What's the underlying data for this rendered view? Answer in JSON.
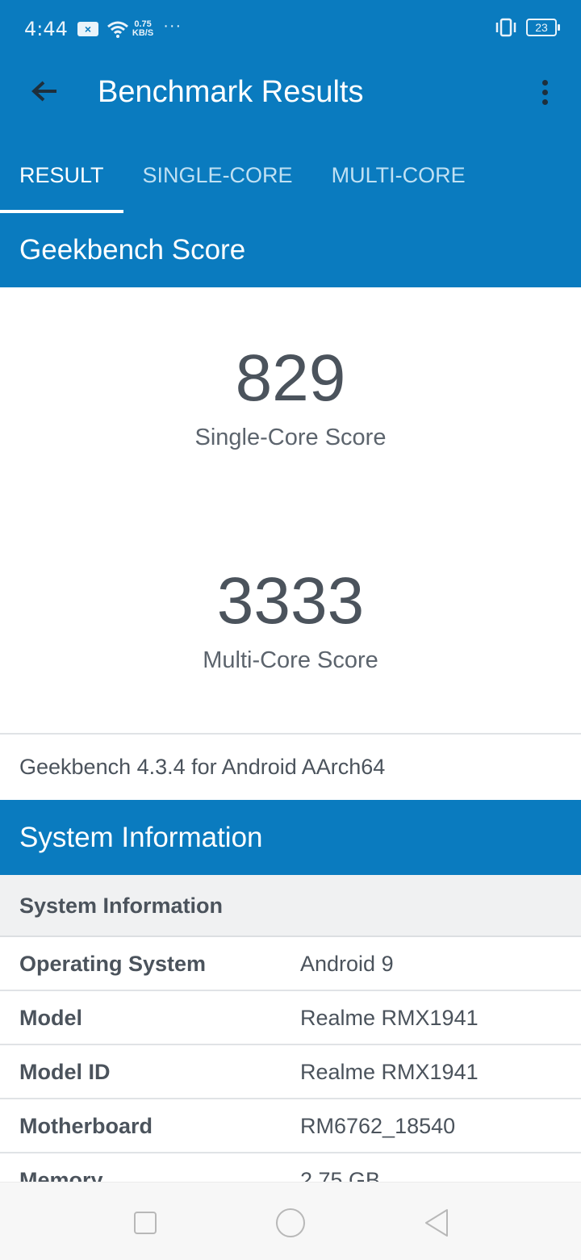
{
  "status_bar": {
    "time": "4:44",
    "net_speed_value": "0.75",
    "net_speed_unit": "KB/S",
    "overflow": "···",
    "battery": "23"
  },
  "app_bar": {
    "title": "Benchmark Results"
  },
  "tabs": [
    {
      "label": "RESULT",
      "active": true
    },
    {
      "label": "SINGLE-CORE",
      "active": false
    },
    {
      "label": "MULTI-CORE",
      "active": false
    }
  ],
  "geekbench": {
    "header": "Geekbench Score",
    "single_core_value": "829",
    "single_core_label": "Single-Core Score",
    "multi_core_value": "3333",
    "multi_core_label": "Multi-Core Score",
    "version": "Geekbench 4.3.4 for Android AArch64"
  },
  "system_information": {
    "header": "System Information",
    "sub_header": "System Information",
    "rows": [
      {
        "key": "Operating System",
        "value": "Android 9"
      },
      {
        "key": "Model",
        "value": "Realme RMX1941"
      },
      {
        "key": "Model ID",
        "value": "Realme RMX1941"
      },
      {
        "key": "Motherboard",
        "value": "RM6762_18540"
      },
      {
        "key": "Memory",
        "value": "2.75 GB"
      }
    ]
  },
  "colors": {
    "primary": "#0a7bbf",
    "text": "#4b535c"
  }
}
